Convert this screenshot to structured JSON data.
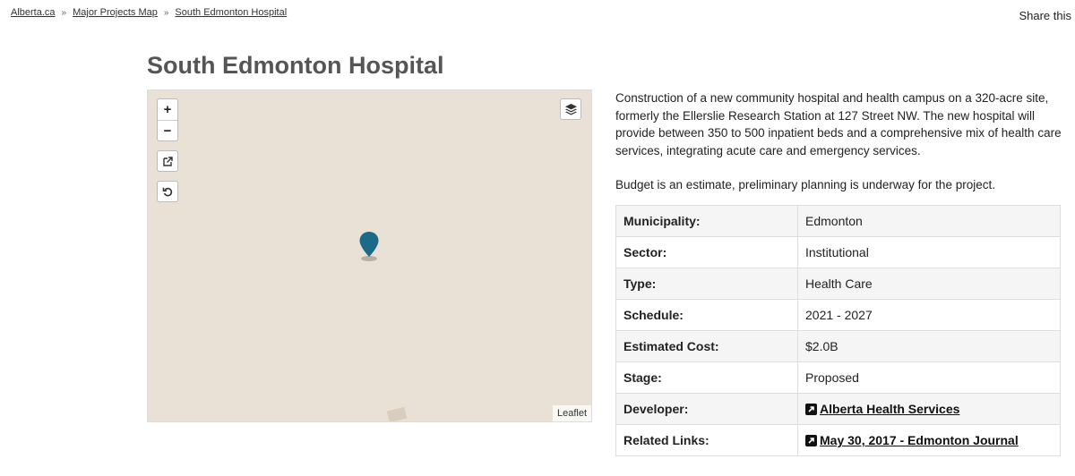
{
  "breadcrumb": {
    "items": [
      "Alberta.ca",
      "Major Projects Map",
      "South Edmonton Hospital"
    ],
    "separator": "»"
  },
  "share_label": "Share this",
  "page_title": "South Edmonton Hospital",
  "map": {
    "zoom_in": "+",
    "zoom_out": "−",
    "attribution": "Leaflet",
    "marker_color": "#1b6a8a",
    "background": "#e9e1d5"
  },
  "description": {
    "paragraph1": "Construction of a new community hospital and health campus on a 320-acre site, formerly the Ellerslie Research Station at 127 Street NW. The new hospital will provide between 350 to 500 inpatient beds and a comprehensive mix of health care services, integrating acute care and emergency services.",
    "paragraph2": "Budget is an estimate, preliminary planning is underway for the project."
  },
  "details": {
    "municipality": {
      "label": "Municipality:",
      "value": "Edmonton"
    },
    "sector": {
      "label": "Sector:",
      "value": "Institutional"
    },
    "type": {
      "label": "Type:",
      "value": "Health Care"
    },
    "schedule": {
      "label": "Schedule:",
      "value": "2021 - 2027"
    },
    "cost": {
      "label": "Estimated Cost:",
      "value": "$2.0B"
    },
    "stage": {
      "label": "Stage:",
      "value": "Proposed"
    },
    "developer": {
      "label": "Developer:",
      "value": "Alberta Health Services",
      "icon": "external-link-icon"
    },
    "related": {
      "label": "Related Links:",
      "value": "May 30, 2017 - Edmonton Journal",
      "icon": "external-link-icon"
    }
  }
}
